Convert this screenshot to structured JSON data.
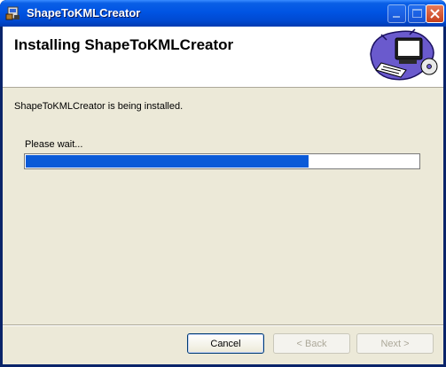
{
  "window": {
    "title": "ShapeToKMLCreator"
  },
  "banner": {
    "title": "Installing ShapeToKMLCreator"
  },
  "status": {
    "message": "ShapeToKMLCreator is being installed.",
    "wait": "Please wait..."
  },
  "progress": {
    "fraction": 0.72
  },
  "buttons": {
    "cancel": "Cancel",
    "back": "< Back",
    "next": "Next >"
  },
  "colors": {
    "titlebar": "#0054e3",
    "progress_fill": "#0a5ad8",
    "dialog_bg": "#ece9d8"
  }
}
